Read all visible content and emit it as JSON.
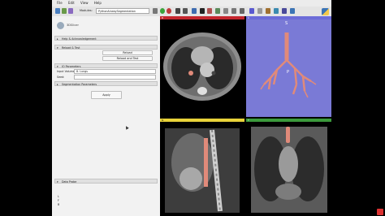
{
  "menubar": {
    "items": [
      "File",
      "Edit",
      "View",
      "Help"
    ]
  },
  "toolbar": {
    "modules_label": "Modules:",
    "module_selected": "PythonAirwaySegmentation"
  },
  "panel": {
    "logo_text": "3DSlicer",
    "sections": {
      "help": "Help & Acknowledgement",
      "reload": "Reload & Test",
      "io": "IO Parameters",
      "seg": "Segmentation Parameters",
      "probe": "Data Probe"
    },
    "buttons": {
      "reload": "Reload",
      "reload_test": "Reload and Test",
      "apply": "Apply"
    },
    "fields": {
      "input_volume_label": "Input Volume:",
      "input_volume_value": "8. Lungs",
      "seed_label": "Seed:"
    },
    "probe_rows": [
      "L",
      "F",
      "B"
    ]
  },
  "views": {
    "axial_tag": "R",
    "threed_tag": "1",
    "sagittal_tag": "G",
    "coronal_tag": "Y",
    "threed_letters": {
      "s": "S",
      "p": "P"
    }
  },
  "colors": {
    "axial_bar": "#c4262e",
    "threed_bar": "#6c6cd8",
    "sagittal_bar": "#e8d23a",
    "coronal_bar": "#3c9a3c",
    "airway": "#e08a7a",
    "threed_bg": "#7a7ad6"
  }
}
